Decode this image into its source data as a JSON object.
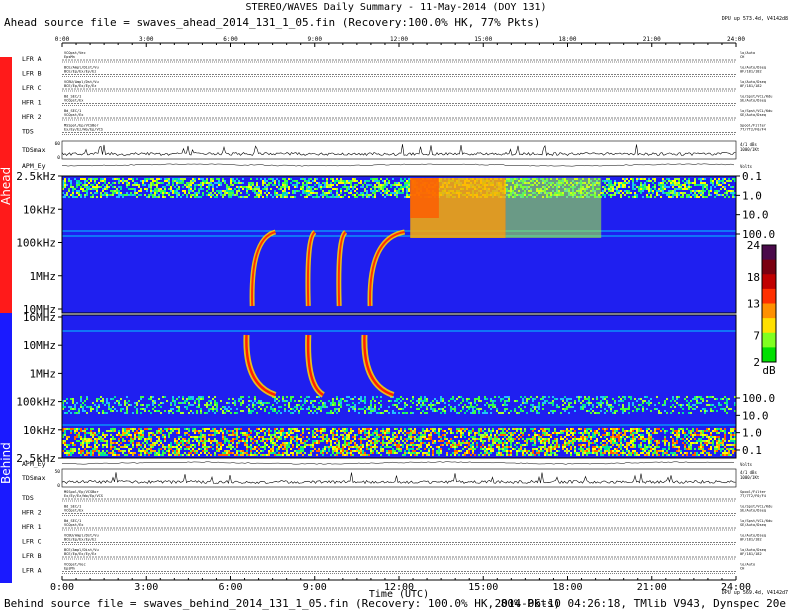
{
  "header": {
    "title": "STEREO/WAVES Daily Summary - 11-May-2014 (DOY 131)",
    "ahead_source": "Ahead source file = swaves_ahead_2014_131_1_05.fin (Recovery:100.0% HK, 77% Pkts)",
    "behind_source": "Behind source file = swaves_behind_2014_131_1_05.fin (Recovery: 100.0% HK, 80% Pkts)",
    "timestamp": "2014-06-10 04:26:18, TMlib V943, Dynspec 20e",
    "dpu_ahead": "DPU up 573.4d, V4142d8",
    "dpu_behind": "DPU up 569.4d, V4142d7"
  },
  "sidebar": {
    "ahead_label": "Ahead",
    "behind_label": "Behind",
    "ahead_color": "#ff1a1a",
    "behind_color": "#1a1aff"
  },
  "chart_data": {
    "type": "heatmap",
    "xlabel": "Time (UTC)",
    "x_ticks": [
      "0:00",
      "3:00",
      "6:00",
      "9:00",
      "12:00",
      "15:00",
      "18:00",
      "21:00",
      "24:00"
    ],
    "xlim": [
      0,
      24
    ],
    "ahead_freq_ticks": [
      "2.5kHz",
      "10kHz",
      "100kHz",
      "1MHz",
      "10MHz"
    ],
    "behind_freq_ticks": [
      "16MHz",
      "10MHz",
      "1MHz",
      "100kHz",
      "10kHz",
      "2.5kHz"
    ],
    "right_scale_ticks": [
      "0.1",
      "1.0",
      "10.0",
      "100.0"
    ],
    "colorbar": {
      "ticks": [
        "24",
        "18",
        "13",
        "7",
        "2"
      ],
      "unit": "dB",
      "range": [
        2,
        24
      ]
    },
    "ahead_status_rows": [
      {
        "label": "LFR A",
        "left_top": "VCOpst/Vec",
        "left_bot": "EpsMn",
        "right_top": "lo/Auto",
        "right_bot": "CH"
      },
      {
        "label": "LFR B",
        "left_top": "BCE/Ampl/Dist/Vu",
        "left_bot": "BCE/Ep/Ex/Ey/Ez",
        "right_top": "lo/Auto/Dseq",
        "right_bot": "0F/181/182"
      },
      {
        "label": "LFR C",
        "left_top": "VCBU/Ampl/Dst/Vu",
        "left_bot": "BCE/Ep/Ex/Ey/Ez",
        "right_top": "lo/Auto/Dseq",
        "right_bot": "0F/181/182"
      },
      {
        "label": "HFR 1",
        "left_top": "Bd_SEC/1",
        "left_bot": "VCOpst/Ex",
        "right_top": "lo/Spst/VCL/Kdu",
        "right_bot": "SE/Auto/Dseq"
      },
      {
        "label": "HFR 2",
        "left_top": "Bd_SEC/1",
        "left_bot": "VCOpst/Ex",
        "right_top": "lo/Spst/VCL/Kdu",
        "right_bot": "SE/Auto/Dseq"
      },
      {
        "label": "TDS",
        "left_top": "MSSpol/Ep/VCSBor",
        "left_bot": "Ex/Ey/Ez/Wo/Ep/VCS",
        "right_top": "Spool/Filter",
        "right_bot": "7T/7T2/F0/F4"
      }
    ],
    "ahead_tdsmax": {
      "label": "TDSmax",
      "ymax": 60,
      "ymin": 0,
      "right": "4/1 dBs",
      "right2": "1000/1Kt"
    },
    "ahead_apm": {
      "label": "APM_Ey",
      "right": "Volts"
    },
    "behind_apm": {
      "label": "APM_Ey",
      "right": "Volts"
    },
    "behind_tdsmax": {
      "label": "TDSmax",
      "ymax": 50,
      "ymin": 0,
      "right": "4/1 dBs",
      "right2": "1000/1Kt"
    },
    "behind_status_rows": [
      {
        "label": "TDS",
        "left_top": "MSSpol/Ep/VCSBor",
        "left_bot": "Ex/Ey/Ez/Wo/Ep/VCS",
        "right_top": "Spool/Filter",
        "right_bot": "7T/7T2/F0/F4"
      },
      {
        "label": "HFR 2",
        "left_top": "Bd_SEC/1",
        "left_bot": "VCOpst/Ex",
        "right_top": "lo/Spst/VCL/Kdu",
        "right_bot": "SE/Auto/Dseq"
      },
      {
        "label": "HFR 1",
        "left_top": "Bd_SEC/1",
        "left_bot": "VCOpst/Ex",
        "right_top": "lo/Spst/VCL/Kdu",
        "right_bot": "SE/Auto/Dseq"
      },
      {
        "label": "LFR C",
        "left_top": "VCBU/Ampl/Dst/Vu",
        "left_bot": "BCE/Ep/Ex/Ey/Ez",
        "right_top": "lo/Auto/Dseq",
        "right_bot": "0F/181/182"
      },
      {
        "label": "LFR B",
        "left_top": "BCE/Ampl/Dist/Vu",
        "left_bot": "BCE/Ep/Ex/Ey/Ez",
        "right_top": "lo/Auto/Dseq",
        "right_bot": "0F/181/182"
      },
      {
        "label": "LFR A",
        "left_top": "VCOpst/Vec",
        "left_bot": "EpsMn",
        "right_top": "lo/Auto",
        "right_bot": "CH"
      }
    ],
    "radio_bursts": [
      {
        "panel": "ahead",
        "start_hour": 6.7,
        "end_hour": 7.6,
        "note": "type III"
      },
      {
        "panel": "ahead",
        "start_hour": 8.7,
        "end_hour": 9.0,
        "note": "type III"
      },
      {
        "panel": "ahead",
        "start_hour": 9.8,
        "end_hour": 10.1,
        "note": "type III"
      },
      {
        "panel": "ahead",
        "start_hour": 10.9,
        "end_hour": 12.2,
        "note": "type III"
      },
      {
        "panel": "ahead",
        "start_hour": 12.4,
        "end_hour": 19.2,
        "note": "type III"
      },
      {
        "panel": "behind",
        "start_hour": 6.5,
        "end_hour": 7.6,
        "note": "type III"
      },
      {
        "panel": "behind",
        "start_hour": 8.7,
        "end_hour": 9.3,
        "note": "type III"
      },
      {
        "panel": "behind",
        "start_hour": 10.7,
        "end_hour": 11.8,
        "note": "type III"
      }
    ]
  }
}
